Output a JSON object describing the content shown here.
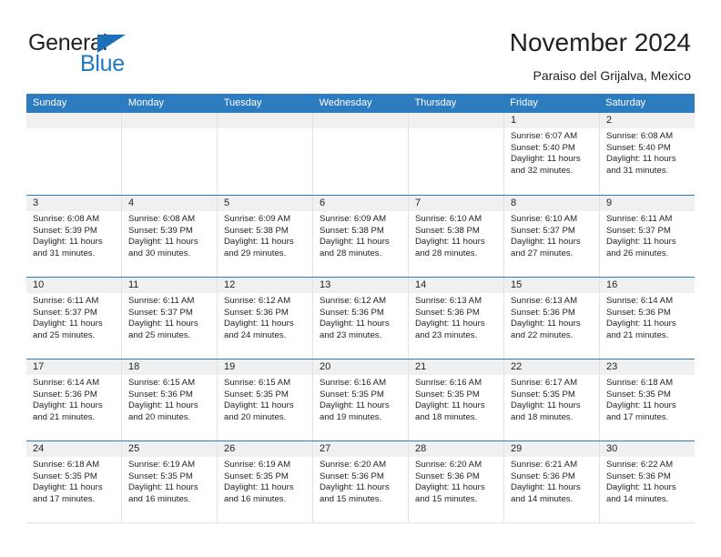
{
  "branding": {
    "word_general": "General",
    "word_blue": "Blue"
  },
  "header": {
    "title": "November 2024",
    "subtitle": "Paraiso del Grijalva, Mexico"
  },
  "calendar": {
    "weekday_headers": [
      "Sunday",
      "Monday",
      "Tuesday",
      "Wednesday",
      "Thursday",
      "Friday",
      "Saturday"
    ],
    "colors": {
      "header_blue": "#2e7cc0",
      "daynum_band": "#f0f0f0",
      "cell_border": "#e2e2e2",
      "text": "#231f20",
      "logo_blue": "#2079c3"
    },
    "weeks": [
      [
        {
          "day": "",
          "sunrise": "",
          "sunset": "",
          "daylight": ""
        },
        {
          "day": "",
          "sunrise": "",
          "sunset": "",
          "daylight": ""
        },
        {
          "day": "",
          "sunrise": "",
          "sunset": "",
          "daylight": ""
        },
        {
          "day": "",
          "sunrise": "",
          "sunset": "",
          "daylight": ""
        },
        {
          "day": "",
          "sunrise": "",
          "sunset": "",
          "daylight": ""
        },
        {
          "day": "1",
          "sunrise": "Sunrise: 6:07 AM",
          "sunset": "Sunset: 5:40 PM",
          "daylight": "Daylight: 11 hours and 32 minutes."
        },
        {
          "day": "2",
          "sunrise": "Sunrise: 6:08 AM",
          "sunset": "Sunset: 5:40 PM",
          "daylight": "Daylight: 11 hours and 31 minutes."
        }
      ],
      [
        {
          "day": "3",
          "sunrise": "Sunrise: 6:08 AM",
          "sunset": "Sunset: 5:39 PM",
          "daylight": "Daylight: 11 hours and 31 minutes."
        },
        {
          "day": "4",
          "sunrise": "Sunrise: 6:08 AM",
          "sunset": "Sunset: 5:39 PM",
          "daylight": "Daylight: 11 hours and 30 minutes."
        },
        {
          "day": "5",
          "sunrise": "Sunrise: 6:09 AM",
          "sunset": "Sunset: 5:38 PM",
          "daylight": "Daylight: 11 hours and 29 minutes."
        },
        {
          "day": "6",
          "sunrise": "Sunrise: 6:09 AM",
          "sunset": "Sunset: 5:38 PM",
          "daylight": "Daylight: 11 hours and 28 minutes."
        },
        {
          "day": "7",
          "sunrise": "Sunrise: 6:10 AM",
          "sunset": "Sunset: 5:38 PM",
          "daylight": "Daylight: 11 hours and 28 minutes."
        },
        {
          "day": "8",
          "sunrise": "Sunrise: 6:10 AM",
          "sunset": "Sunset: 5:37 PM",
          "daylight": "Daylight: 11 hours and 27 minutes."
        },
        {
          "day": "9",
          "sunrise": "Sunrise: 6:11 AM",
          "sunset": "Sunset: 5:37 PM",
          "daylight": "Daylight: 11 hours and 26 minutes."
        }
      ],
      [
        {
          "day": "10",
          "sunrise": "Sunrise: 6:11 AM",
          "sunset": "Sunset: 5:37 PM",
          "daylight": "Daylight: 11 hours and 25 minutes."
        },
        {
          "day": "11",
          "sunrise": "Sunrise: 6:11 AM",
          "sunset": "Sunset: 5:37 PM",
          "daylight": "Daylight: 11 hours and 25 minutes."
        },
        {
          "day": "12",
          "sunrise": "Sunrise: 6:12 AM",
          "sunset": "Sunset: 5:36 PM",
          "daylight": "Daylight: 11 hours and 24 minutes."
        },
        {
          "day": "13",
          "sunrise": "Sunrise: 6:12 AM",
          "sunset": "Sunset: 5:36 PM",
          "daylight": "Daylight: 11 hours and 23 minutes."
        },
        {
          "day": "14",
          "sunrise": "Sunrise: 6:13 AM",
          "sunset": "Sunset: 5:36 PM",
          "daylight": "Daylight: 11 hours and 23 minutes."
        },
        {
          "day": "15",
          "sunrise": "Sunrise: 6:13 AM",
          "sunset": "Sunset: 5:36 PM",
          "daylight": "Daylight: 11 hours and 22 minutes."
        },
        {
          "day": "16",
          "sunrise": "Sunrise: 6:14 AM",
          "sunset": "Sunset: 5:36 PM",
          "daylight": "Daylight: 11 hours and 21 minutes."
        }
      ],
      [
        {
          "day": "17",
          "sunrise": "Sunrise: 6:14 AM",
          "sunset": "Sunset: 5:36 PM",
          "daylight": "Daylight: 11 hours and 21 minutes."
        },
        {
          "day": "18",
          "sunrise": "Sunrise: 6:15 AM",
          "sunset": "Sunset: 5:36 PM",
          "daylight": "Daylight: 11 hours and 20 minutes."
        },
        {
          "day": "19",
          "sunrise": "Sunrise: 6:15 AM",
          "sunset": "Sunset: 5:35 PM",
          "daylight": "Daylight: 11 hours and 20 minutes."
        },
        {
          "day": "20",
          "sunrise": "Sunrise: 6:16 AM",
          "sunset": "Sunset: 5:35 PM",
          "daylight": "Daylight: 11 hours and 19 minutes."
        },
        {
          "day": "21",
          "sunrise": "Sunrise: 6:16 AM",
          "sunset": "Sunset: 5:35 PM",
          "daylight": "Daylight: 11 hours and 18 minutes."
        },
        {
          "day": "22",
          "sunrise": "Sunrise: 6:17 AM",
          "sunset": "Sunset: 5:35 PM",
          "daylight": "Daylight: 11 hours and 18 minutes."
        },
        {
          "day": "23",
          "sunrise": "Sunrise: 6:18 AM",
          "sunset": "Sunset: 5:35 PM",
          "daylight": "Daylight: 11 hours and 17 minutes."
        }
      ],
      [
        {
          "day": "24",
          "sunrise": "Sunrise: 6:18 AM",
          "sunset": "Sunset: 5:35 PM",
          "daylight": "Daylight: 11 hours and 17 minutes."
        },
        {
          "day": "25",
          "sunrise": "Sunrise: 6:19 AM",
          "sunset": "Sunset: 5:35 PM",
          "daylight": "Daylight: 11 hours and 16 minutes."
        },
        {
          "day": "26",
          "sunrise": "Sunrise: 6:19 AM",
          "sunset": "Sunset: 5:35 PM",
          "daylight": "Daylight: 11 hours and 16 minutes."
        },
        {
          "day": "27",
          "sunrise": "Sunrise: 6:20 AM",
          "sunset": "Sunset: 5:36 PM",
          "daylight": "Daylight: 11 hours and 15 minutes."
        },
        {
          "day": "28",
          "sunrise": "Sunrise: 6:20 AM",
          "sunset": "Sunset: 5:36 PM",
          "daylight": "Daylight: 11 hours and 15 minutes."
        },
        {
          "day": "29",
          "sunrise": "Sunrise: 6:21 AM",
          "sunset": "Sunset: 5:36 PM",
          "daylight": "Daylight: 11 hours and 14 minutes."
        },
        {
          "day": "30",
          "sunrise": "Sunrise: 6:22 AM",
          "sunset": "Sunset: 5:36 PM",
          "daylight": "Daylight: 11 hours and 14 minutes."
        }
      ]
    ]
  }
}
